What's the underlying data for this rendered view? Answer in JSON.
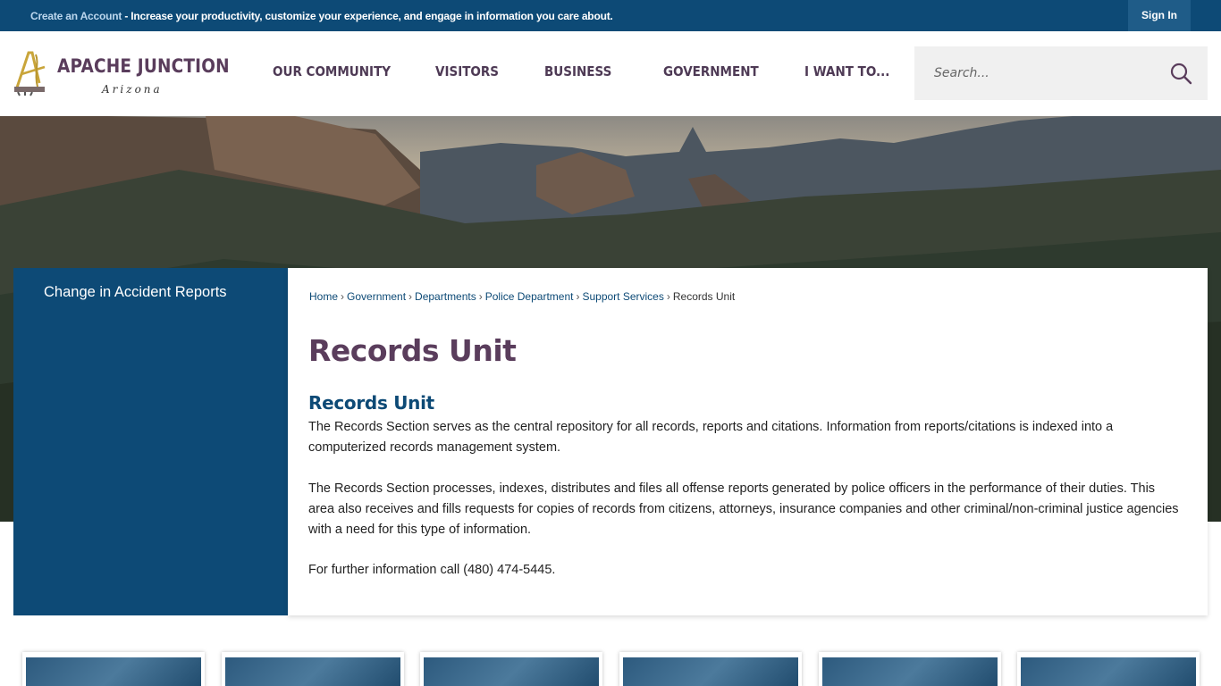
{
  "topbar": {
    "create_account": "Create an Account",
    "message": " - Increase your productivity, customize your experience, and engage in information you care about.",
    "sign_in": "Sign In"
  },
  "logo": {
    "title": "APACHE JUNCTION",
    "subtitle": "Arizona"
  },
  "nav": [
    {
      "label": "OUR COMMUNITY"
    },
    {
      "label": "VISITORS"
    },
    {
      "label": "BUSINESS"
    },
    {
      "label": "GOVERNMENT"
    },
    {
      "label": "I WANT TO..."
    }
  ],
  "search": {
    "placeholder": "Search..."
  },
  "sidebar": {
    "items": [
      {
        "label": "Change in Accident Reports"
      }
    ]
  },
  "breadcrumb": [
    {
      "label": "Home"
    },
    {
      "label": "Government"
    },
    {
      "label": "Departments"
    },
    {
      "label": "Police Department"
    },
    {
      "label": "Support Services"
    },
    {
      "label": "Records Unit"
    }
  ],
  "main": {
    "page_title": "Records Unit",
    "section_title": "Records Unit",
    "paragraphs": [
      "The Records Section serves as the central repository for all records, reports and citations. Information from reports/citations is indexed into a computerized records management system.",
      "The Records Section processes, indexes, distributes and files all offense reports generated by police officers in the performance of their duties. This area also receives and fills requests for copies of records from citizens, attorneys, insurance companies and other criminal/non-criminal justice agencies with a need for this type of information.",
      "For further information call (480) 474-5445."
    ]
  },
  "colors": {
    "brand_blue": "#0d4a76",
    "brand_purple": "#5a3d5c"
  }
}
